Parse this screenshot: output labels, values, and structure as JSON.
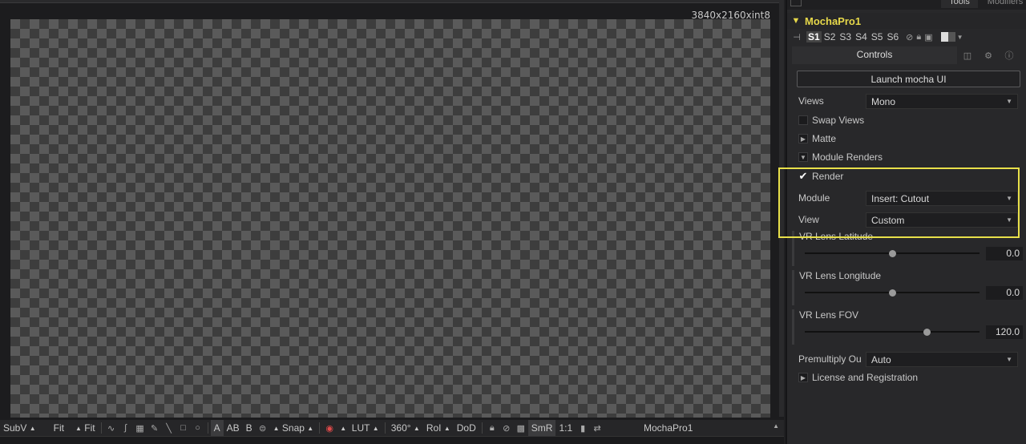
{
  "viewer": {
    "resolution": "3840x2160xint8",
    "toolbar": {
      "subv": "SubV",
      "fit1": "Fit",
      "fit2": "Fit",
      "a": "A",
      "ab": "AB",
      "b": "B",
      "snap": "Snap",
      "lut": "LUT",
      "deg": "360°",
      "roi": "RoI",
      "dod": "DoD",
      "smr": "SmR",
      "ratio": "1:1",
      "node_name": "MochaPro1"
    }
  },
  "inspector": {
    "top_tabs": {
      "tools": "Tools",
      "modifiers": "Modifiers"
    },
    "node_title": "MochaPro1",
    "slots": [
      "S1",
      "S2",
      "S3",
      "S4",
      "S5",
      "S6"
    ],
    "active_slot": "S1",
    "controls_tab": "Controls",
    "launch_button": "Launch mocha UI",
    "views_label": "Views",
    "views_value": "Mono",
    "swap_views": "Swap Views",
    "matte": "Matte",
    "module_renders": "Module Renders",
    "render": "Render",
    "render_checked": true,
    "module_label": "Module",
    "module_value": "Insert: Cutout",
    "view_label": "View",
    "view_value": "Custom",
    "sliders": [
      {
        "label": "VR Lens Latitude",
        "value": "0.0",
        "position": 0.5
      },
      {
        "label": "VR Lens Longitude",
        "value": "0.0",
        "position": 0.5
      },
      {
        "label": "VR Lens FOV",
        "value": "120.0",
        "position": 0.7
      }
    ],
    "premultiply_label": "Premultiply Ou",
    "premultiply_value": "Auto",
    "license": "License and Registration"
  },
  "colors": {
    "accent_yellow": "#e6d84a",
    "highlight_box": "#e8e04a"
  }
}
